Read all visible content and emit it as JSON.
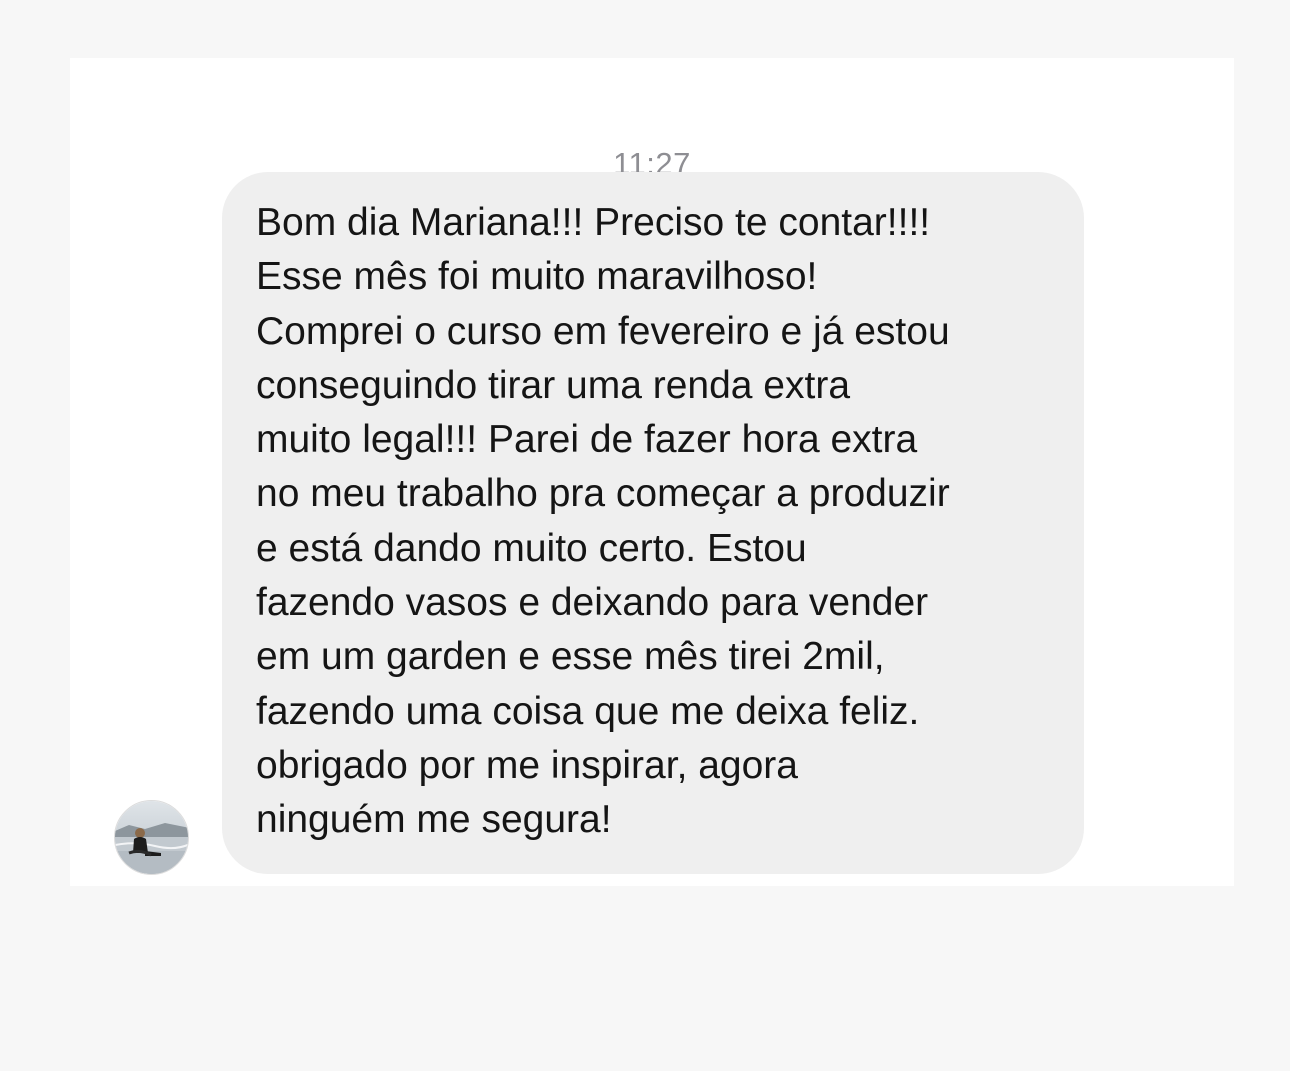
{
  "conversation": {
    "timestamp": "11:27",
    "message": {
      "lines": [
        "Bom dia Mariana!!! Preciso te contar!!!!",
        "Esse mês foi muito maravilhoso!",
        "Comprei o curso em fevereiro e já estou",
        "conseguindo tirar uma renda extra",
        "muito legal!!! Parei de fazer hora extra",
        "no meu trabalho pra começar a produzir",
        "e está dando muito certo. Estou",
        "fazendo vasos e deixando para vender",
        "em um garden e esse mês tirei 2mil,",
        "fazendo uma coisa que me deixa feliz.",
        "obrigado por me inspirar, agora",
        "ninguém me segura!"
      ]
    },
    "sender_avatar": "avatar-photo-beach"
  },
  "colors": {
    "page_background": "#f7f7f7",
    "card_background": "#ffffff",
    "bubble_background": "#efefef",
    "text": "#151515",
    "timestamp": "#8e8e93"
  }
}
